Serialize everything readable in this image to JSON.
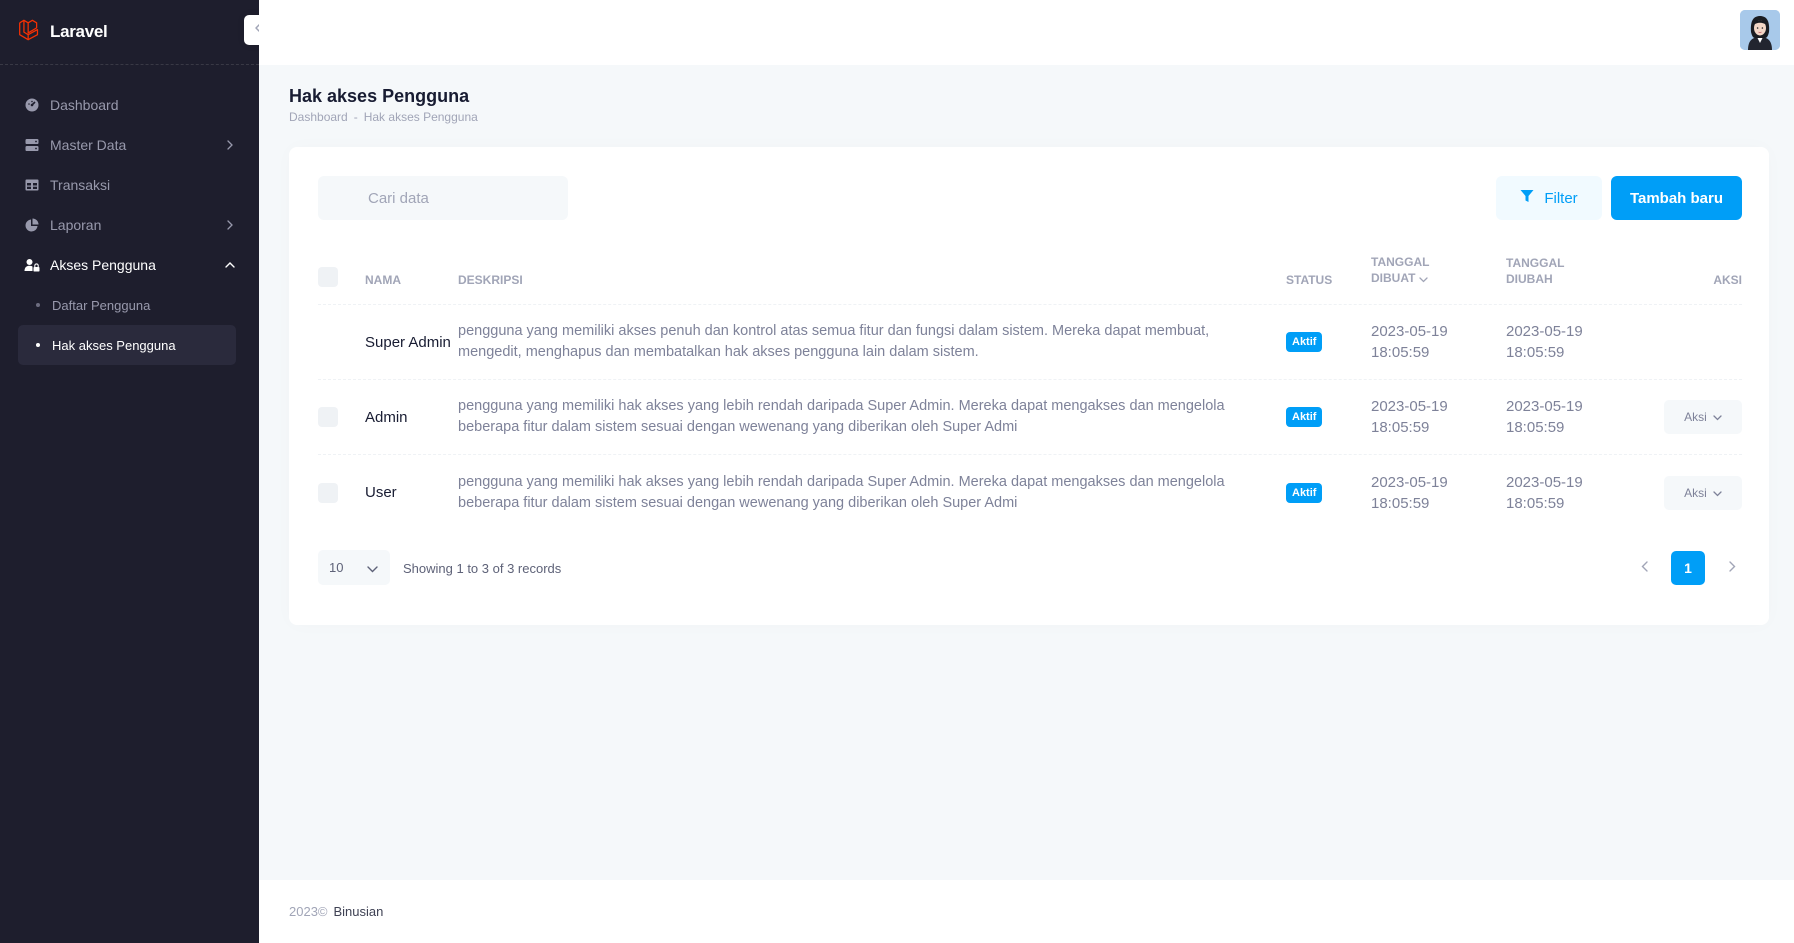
{
  "sidebar": {
    "logo_text": "Laravel",
    "items": [
      {
        "label": "Dashboard",
        "icon": "dashboard-icon"
      },
      {
        "label": "Master Data",
        "icon": "server-icon"
      },
      {
        "label": "Transaksi",
        "icon": "table-icon"
      },
      {
        "label": "Laporan",
        "icon": "pie-chart-icon"
      },
      {
        "label": "Akses Pengguna",
        "icon": "user-lock-icon"
      }
    ],
    "subitems": [
      {
        "label": "Daftar Pengguna"
      },
      {
        "label": "Hak akses Pengguna"
      }
    ]
  },
  "page": {
    "title": "Hak akses Pengguna",
    "breadcrumb": [
      "Dashboard",
      "-",
      "Hak akses Pengguna"
    ]
  },
  "toolbar": {
    "search_placeholder": "Cari data",
    "filter_label": "Filter",
    "add_label": "Tambah baru"
  },
  "table": {
    "headers": {
      "name": "NAMA",
      "desc": "DESKRIPSI",
      "status": "STATUS",
      "created_1": "TANGGAL",
      "created_2": "DIBUAT",
      "updated_1": "TANGGAL",
      "updated_2": "DIUBAH",
      "action": "AKSI"
    },
    "rows": [
      {
        "name": "Super Admin",
        "desc": "pengguna yang memiliki akses penuh dan kontrol atas semua fitur dan fungsi dalam sistem. Mereka dapat membuat, mengedit, menghapus dan membatalkan hak akses pengguna lain dalam sistem.",
        "status": "Aktif",
        "created_date": "2023-05-19",
        "created_time": "18:05:59",
        "updated_date": "2023-05-19",
        "updated_time": "18:05:59",
        "action": ""
      },
      {
        "name": "Admin",
        "desc": "pengguna yang memiliki hak akses yang lebih rendah daripada Super Admin. Mereka dapat mengakses dan mengelola beberapa fitur dalam sistem sesuai dengan wewenang yang diberikan oleh Super Admi",
        "status": "Aktif",
        "created_date": "2023-05-19",
        "created_time": "18:05:59",
        "updated_date": "2023-05-19",
        "updated_time": "18:05:59",
        "action": "Aksi"
      },
      {
        "name": "User",
        "desc": "pengguna yang memiliki hak akses yang lebih rendah daripada Super Admin. Mereka dapat mengakses dan mengelola beberapa fitur dalam sistem sesuai dengan wewenang yang diberikan oleh Super Admi",
        "status": "Aktif",
        "created_date": "2023-05-19",
        "created_time": "18:05:59",
        "updated_date": "2023-05-19",
        "updated_time": "18:05:59",
        "action": "Aksi"
      }
    ]
  },
  "pagination": {
    "per_page": "10",
    "records_text": "Showing 1 to 3 of 3 records",
    "current_page": "1"
  },
  "footer": {
    "year": "2023©",
    "brand": "Binusian"
  },
  "colors": {
    "primary": "#009ef7",
    "sidebar_bg": "#1e1e2d",
    "laravel_red": "#f53003"
  }
}
